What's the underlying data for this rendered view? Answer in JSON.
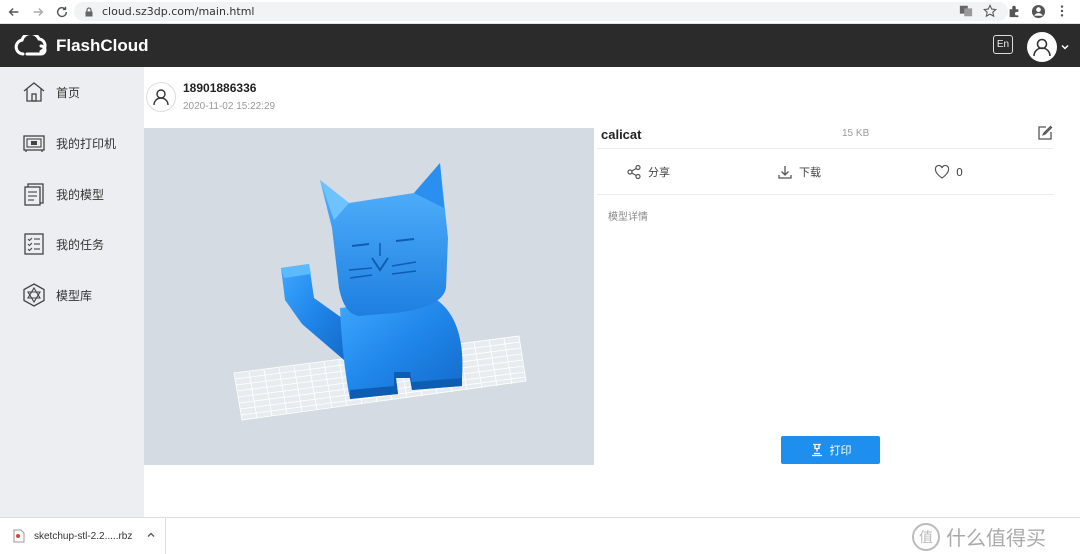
{
  "browser": {
    "url": "cloud.sz3dp.com/main.html"
  },
  "header": {
    "brand": "FlashCloud",
    "lang_label": "En"
  },
  "sidebar": {
    "items": [
      {
        "label": "首页",
        "icon": "home-icon"
      },
      {
        "label": "我的打印机",
        "icon": "printer-icon"
      },
      {
        "label": "我的模型",
        "icon": "model-icon"
      },
      {
        "label": "我的任务",
        "icon": "task-list-icon"
      },
      {
        "label": "模型库",
        "icon": "library-icon"
      }
    ]
  },
  "user": {
    "phone": "18901886336",
    "timestamp": "2020-11-02 15:22:29"
  },
  "model": {
    "name": "calicat",
    "size": "15 KB",
    "actions": {
      "share": "分享",
      "download": "下载",
      "likes": "0"
    },
    "details_label": "模型详情",
    "print_label": "打印"
  },
  "download_bar": {
    "filename": "sketchup-stl-2.2.....rbz"
  },
  "watermark": {
    "text": "什么值得买"
  },
  "colors": {
    "header_bg": "#2b2b2b",
    "sidebar_bg": "#eceef1",
    "preview_bg": "#d4dbe3",
    "accent": "#1e8fef",
    "model": "#2a8ef0"
  }
}
